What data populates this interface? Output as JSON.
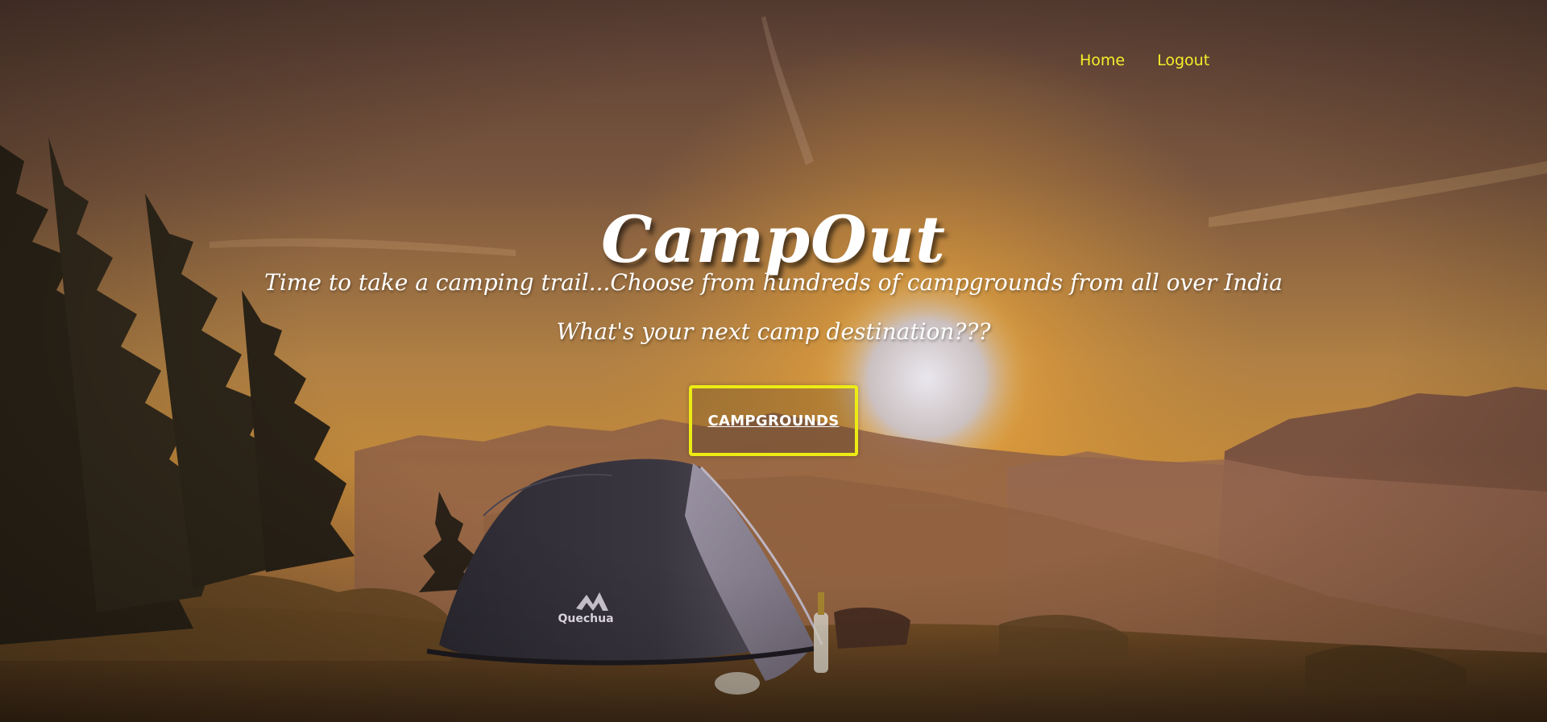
{
  "nav": {
    "home_label": "Home",
    "logout_label": "Logout"
  },
  "hero": {
    "title": "CampOut",
    "tagline_line1": "Time to take a camping trail...Choose from hundreds of campgrounds from all over India",
    "tagline_line2": "What's your next camp destination???",
    "cta_label": "CAMPGROUNDS",
    "tent_brand": "Quechua"
  },
  "colors": {
    "nav_link": "#f5ee2a",
    "cta_border": "#ecec14",
    "title_text": "#ffffff"
  }
}
